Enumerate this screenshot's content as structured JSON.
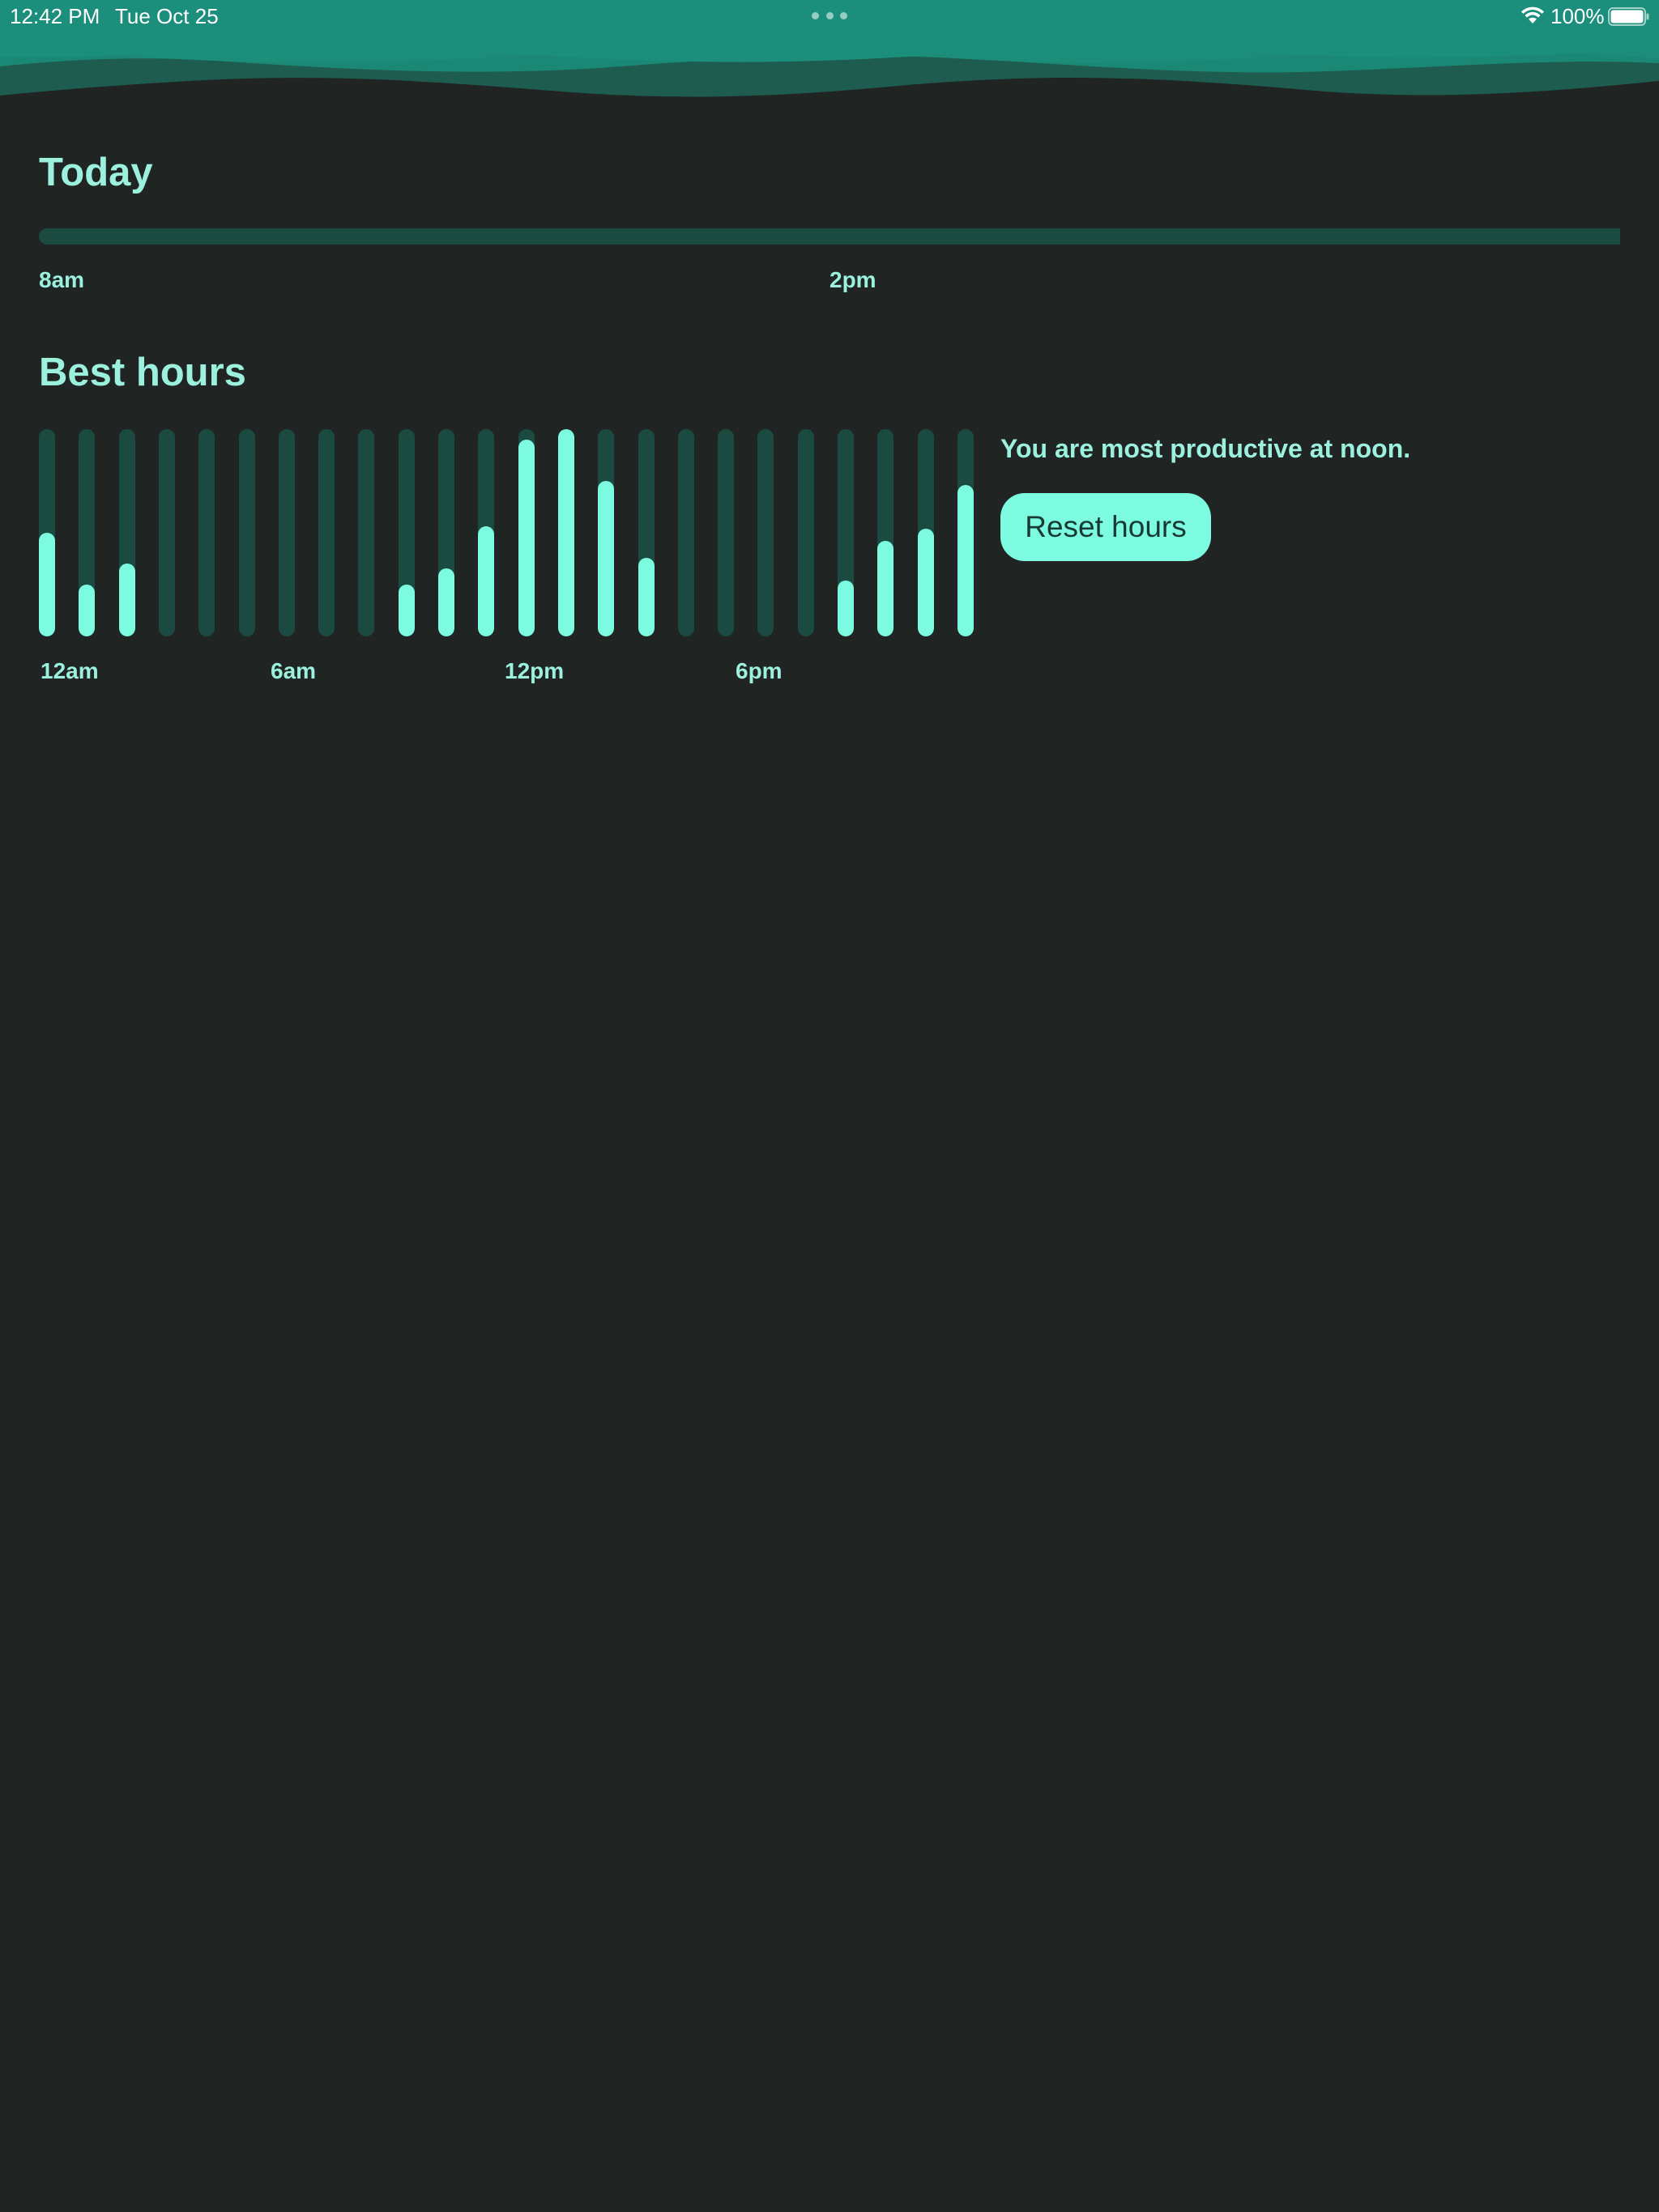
{
  "status_bar": {
    "time": "12:42 PM",
    "date": "Tue Oct 25",
    "battery_percent": "100%",
    "battery_level": 1.0,
    "icons": [
      "multitasking-dots-icon",
      "wifi-icon",
      "battery-icon"
    ]
  },
  "colors": {
    "background": "#202423",
    "header": "#1b8f7b",
    "accent": "#7dfbe1",
    "accent_text": "#9bf1de",
    "track": "#1a4a40"
  },
  "today": {
    "title": "Today",
    "progress": 0,
    "start_label": "8am",
    "mid_label": "2pm"
  },
  "best_hours": {
    "title": "Best hours",
    "insight": "You are most productive at noon.",
    "reset_label": "Reset hours",
    "axis_labels": [
      "12am",
      "6am",
      "12pm",
      "6pm"
    ]
  },
  "chart_data": {
    "type": "bar",
    "x": [
      0,
      1,
      2,
      3,
      4,
      5,
      6,
      7,
      8,
      9,
      10,
      11,
      12,
      13,
      14,
      15,
      16,
      17,
      18,
      19,
      20,
      21,
      22,
      23
    ],
    "values": [
      0.5,
      0.25,
      0.35,
      0,
      0,
      0,
      0,
      0,
      0,
      0.25,
      0.33,
      0.53,
      0.95,
      1.0,
      0.75,
      0.38,
      0,
      0,
      0,
      0,
      0.27,
      0.46,
      0.52,
      0.73
    ],
    "tick_labels": [
      "12am",
      "6am",
      "12pm",
      "6pm"
    ],
    "ylim": [
      0,
      1
    ]
  }
}
